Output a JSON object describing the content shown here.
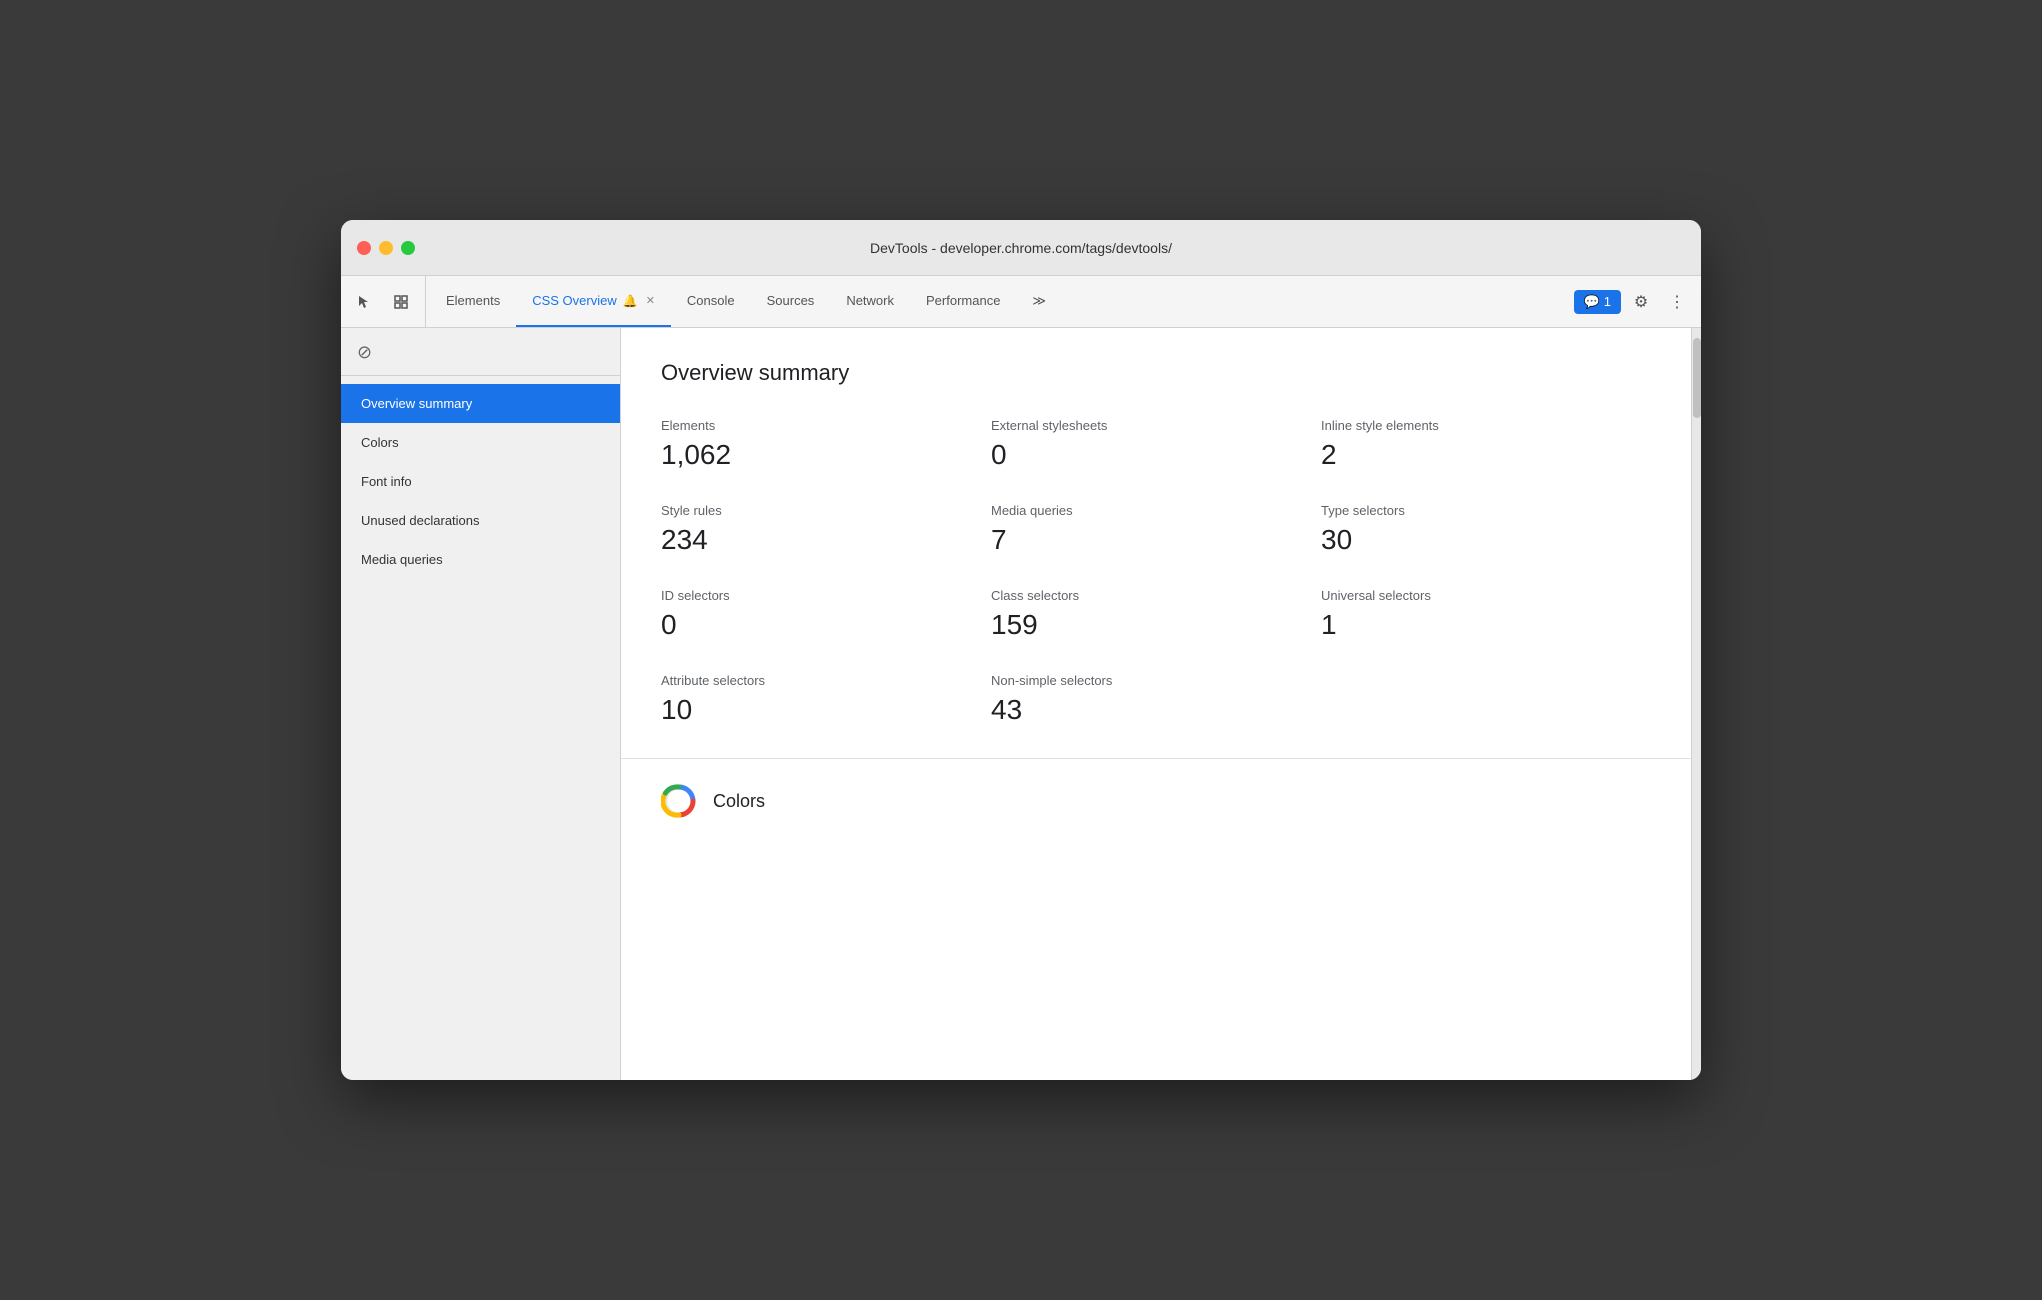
{
  "window": {
    "title": "DevTools - developer.chrome.com/tags/devtools/"
  },
  "tabs": [
    {
      "id": "elements",
      "label": "Elements",
      "active": false,
      "closeable": false
    },
    {
      "id": "css-overview",
      "label": "CSS Overview",
      "active": true,
      "closeable": true,
      "hasIcon": true
    },
    {
      "id": "console",
      "label": "Console",
      "active": false,
      "closeable": false
    },
    {
      "id": "sources",
      "label": "Sources",
      "active": false,
      "closeable": false
    },
    {
      "id": "network",
      "label": "Network",
      "active": false,
      "closeable": false
    },
    {
      "id": "performance",
      "label": "Performance",
      "active": false,
      "closeable": false
    }
  ],
  "toolbar": {
    "more_label": "≫",
    "notification_count": "1",
    "settings_icon": "⚙",
    "more_options_icon": "⋮"
  },
  "sidebar": {
    "items": [
      {
        "id": "overview-summary",
        "label": "Overview summary",
        "active": true
      },
      {
        "id": "colors",
        "label": "Colors",
        "active": false
      },
      {
        "id": "font-info",
        "label": "Font info",
        "active": false
      },
      {
        "id": "unused-declarations",
        "label": "Unused declarations",
        "active": false
      },
      {
        "id": "media-queries",
        "label": "Media queries",
        "active": false
      }
    ]
  },
  "overview": {
    "title": "Overview summary",
    "stats": [
      {
        "label": "Elements",
        "value": "1,062"
      },
      {
        "label": "External stylesheets",
        "value": "0"
      },
      {
        "label": "Inline style elements",
        "value": "2"
      },
      {
        "label": "Style rules",
        "value": "234"
      },
      {
        "label": "Media queries",
        "value": "7"
      },
      {
        "label": "Type selectors",
        "value": "30"
      },
      {
        "label": "ID selectors",
        "value": "0"
      },
      {
        "label": "Class selectors",
        "value": "159"
      },
      {
        "label": "Universal selectors",
        "value": "1"
      },
      {
        "label": "Attribute selectors",
        "value": "10"
      },
      {
        "label": "Non-simple selectors",
        "value": "43"
      }
    ]
  },
  "colors_section": {
    "title": "Colors"
  },
  "icons": {
    "cursor": "⬚",
    "layers": "⧉",
    "block": "⊘",
    "chat": "💬"
  }
}
